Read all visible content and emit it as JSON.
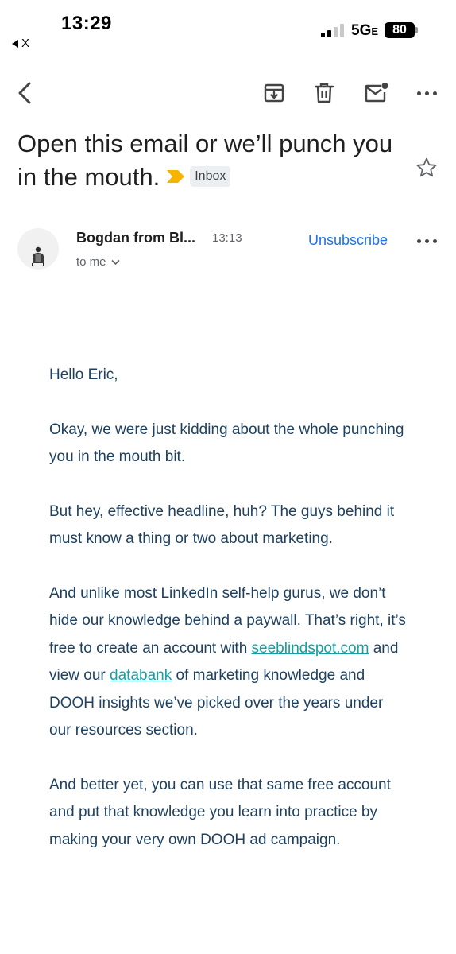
{
  "status_bar": {
    "time": "13:29",
    "back_app": "X",
    "network": "5G",
    "network_suffix": "E",
    "battery": "80"
  },
  "toolbar": {
    "back_icon": "chevron-left-icon",
    "archive_icon": "archive-icon",
    "delete_icon": "trash-icon",
    "unread_icon": "mark-unread-icon",
    "more_icon": "more-horizontal-icon"
  },
  "email": {
    "subject": "Open this email or we’ll punch you in the mouth.",
    "label": "Inbox",
    "sender_name": "Bogdan from Bl...",
    "time": "13:13",
    "recipient": "to me",
    "unsubscribe": "Unsubscribe",
    "body": {
      "greeting": "Hello Eric,",
      "p1": "Okay, we were just kidding about the whole punching you in the mouth bit.",
      "p2": "But hey, effective headline, huh? The guys behind it must know a thing or two about marketing.",
      "p3_before": "And unlike most LinkedIn self-help gurus, we don’t hide our knowledge behind a paywall. That’s right, it’s free to create an account with ",
      "p3_link1": "seeblindspot.com",
      "p3_middle": " and view our ",
      "p3_link2": "databank",
      "p3_after": " of marketing knowledge and DOOH insights we’ve picked over the years under our resources section.",
      "p4": "And better yet, you can use that same free account and put that knowledge you learn into practice by making your very own DOOH ad campaign."
    }
  },
  "colors": {
    "accent": "#1a73e8",
    "body_text": "#1f4160",
    "link": "#15a0a3",
    "important_marker": "#f4b400"
  }
}
